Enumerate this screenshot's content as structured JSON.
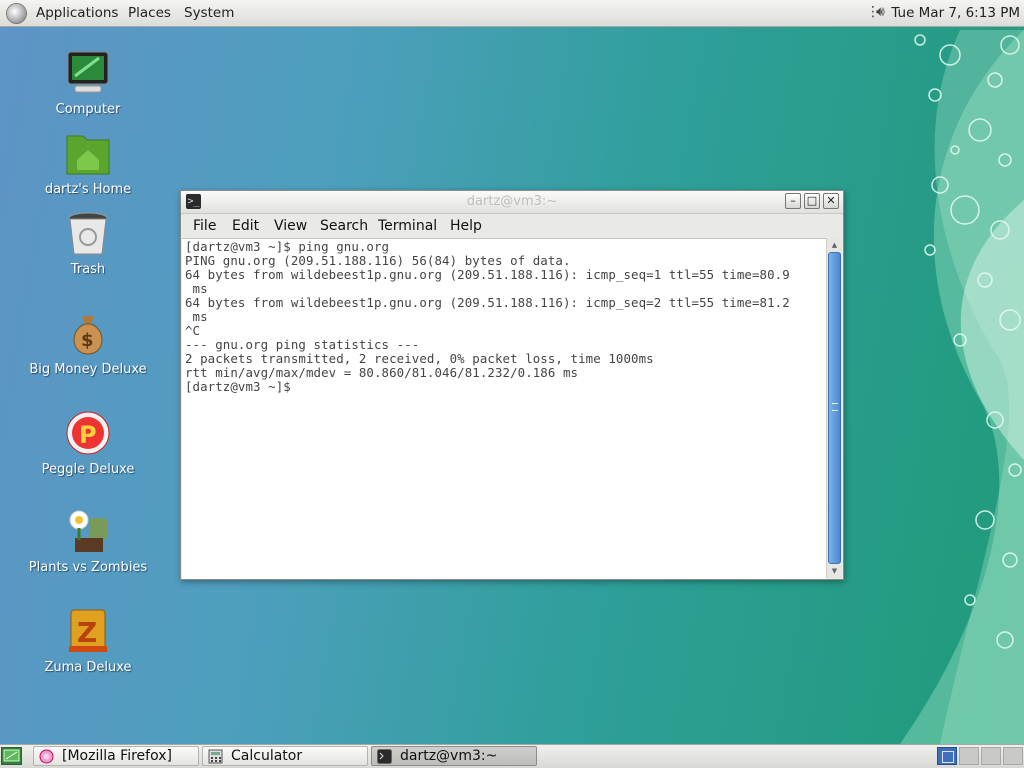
{
  "top_panel": {
    "menus": [
      "Applications",
      "Places",
      "System"
    ],
    "clock": "Tue Mar  7,  6:13 PM"
  },
  "desktop_icons": [
    {
      "label": "Computer",
      "icon": "computer-icon"
    },
    {
      "label": "dartz's Home",
      "icon": "home-folder-icon"
    },
    {
      "label": "Trash",
      "icon": "trash-icon"
    },
    {
      "label": "Big Money Deluxe",
      "icon": "money-bag-icon"
    },
    {
      "label": "Peggle Deluxe",
      "icon": "peggle-icon"
    },
    {
      "label": "Plants vs Zombies",
      "icon": "plants-vs-zombies-icon"
    },
    {
      "label": "Zuma Deluxe",
      "icon": "zuma-icon"
    }
  ],
  "terminal": {
    "title": "dartz@vm3:~",
    "menus": [
      "File",
      "Edit",
      "View",
      "Search",
      "Terminal",
      "Help"
    ],
    "lines": [
      "[dartz@vm3 ~]$ ping gnu.org",
      "PING gnu.org (209.51.188.116) 56(84) bytes of data.",
      "64 bytes from wildebeest1p.gnu.org (209.51.188.116): icmp_seq=1 ttl=55 time=80.9",
      " ms",
      "64 bytes from wildebeest1p.gnu.org (209.51.188.116): icmp_seq=2 ttl=55 time=81.2",
      " ms",
      "^C",
      "--- gnu.org ping statistics ---",
      "2 packets transmitted, 2 received, 0% packet loss, time 1000ms",
      "rtt min/avg/max/mdev = 80.860/81.046/81.232/0.186 ms",
      "[dartz@vm3 ~]$ "
    ]
  },
  "taskbar": {
    "tasks": [
      {
        "label": "[Mozilla Firefox]",
        "icon": "firefox-icon",
        "active": false
      },
      {
        "label": "Calculator",
        "icon": "calculator-icon",
        "active": false
      },
      {
        "label": "dartz@vm3:~",
        "icon": "terminal-icon",
        "active": true
      }
    ],
    "workspaces": 4,
    "active_workspace": 1
  }
}
